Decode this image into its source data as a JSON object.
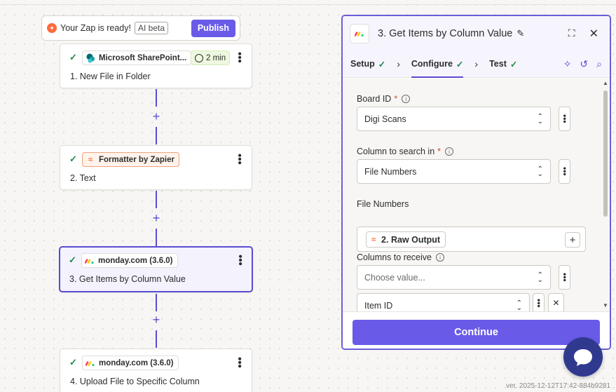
{
  "banner": {
    "text": "Your Zap is ready!",
    "beta": "AI beta",
    "publish": "Publish"
  },
  "steps": [
    {
      "app": "Microsoft SharePoint...",
      "time": "2 min",
      "title": "1. New File in Folder"
    },
    {
      "app": "Formatter by Zapier",
      "title": "2. Text"
    },
    {
      "app": "monday.com (3.6.0)",
      "title": "3. Get Items by Column Value"
    },
    {
      "app": "monday.com (3.6.0)",
      "title": "4. Upload File to Specific Column"
    }
  ],
  "panel": {
    "title": "3. Get Items by Column Value",
    "tabs": [
      {
        "label": "Setup"
      },
      {
        "label": "Configure"
      },
      {
        "label": "Test"
      }
    ],
    "fields": {
      "board_id": {
        "label": "Board ID",
        "value": "Digi Scans"
      },
      "column_search": {
        "label": "Column to search in",
        "value": "File Numbers"
      },
      "file_numbers": {
        "label": "File Numbers",
        "pill": "2. Raw Output"
      },
      "columns_receive": {
        "label": "Columns to receive",
        "placeholder": "Choose value...",
        "item": "Item ID"
      }
    },
    "continue": "Continue"
  },
  "version": "ver. 2025-12-12T17:42-884b9281",
  "colors": {
    "accent": "#695be8",
    "active_border": "#5a4ccf",
    "success": "#1d8a4b",
    "required": "#d44a1f"
  }
}
